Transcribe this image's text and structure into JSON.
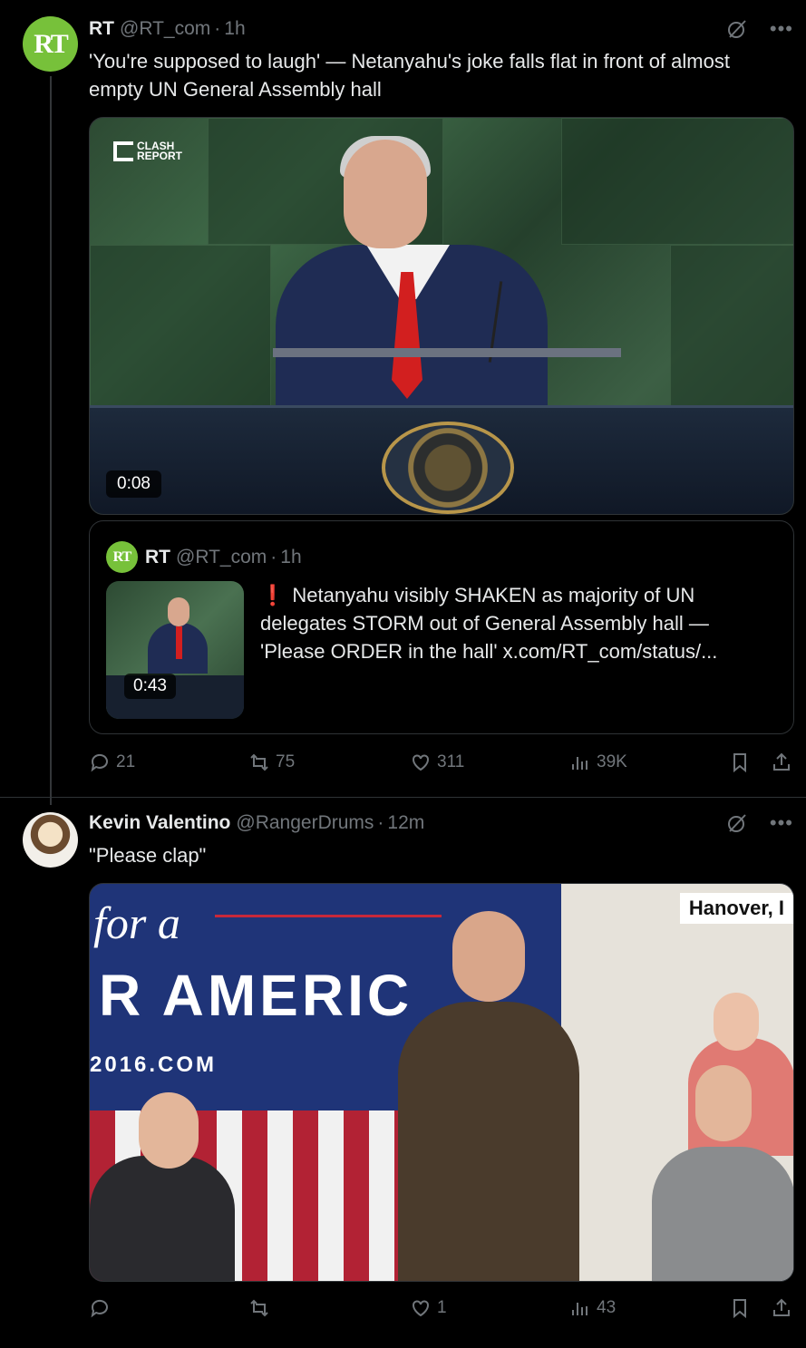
{
  "tweets": [
    {
      "author": "RT",
      "handle": "@RT_com",
      "time": "1h",
      "avatar_text": "RT",
      "text": "'You're supposed to laugh' — Netanyahu's joke falls flat in front of almost empty UN General Assembly hall",
      "media": {
        "duration": "0:08",
        "watermark_line1": "CLASH",
        "watermark_line2": "REPORT"
      },
      "quote": {
        "author": "RT",
        "handle": "@RT_com",
        "time": "1h",
        "avatar_text": "RT",
        "alert_icon": "❗",
        "text": "Netanyahu visibly SHAKEN as majority of UN delegates STORM out of General Assembly hall — 'Please ORDER in the hall'  x.com/RT_com/status/...",
        "duration": "0:43"
      },
      "actions": {
        "replies": "21",
        "reposts": "75",
        "likes": "311",
        "views": "39K"
      }
    },
    {
      "author": "Kevin Valentino",
      "handle": "@RangerDrums",
      "time": "12m",
      "text": "\"Please clap\"",
      "media": {
        "banner_line1": "for a",
        "banner_line2": "R AMERIC",
        "banner_line3": "2016.COM",
        "location": "Hanover, I"
      },
      "actions": {
        "replies": "",
        "reposts": "",
        "likes": "1",
        "views": "43"
      }
    }
  ],
  "colors": {
    "background": "#000000",
    "text": "#e7e9ea",
    "muted": "#71767b",
    "border": "#2f3336",
    "rt_green": "#77c13a"
  },
  "icons": [
    "grok-icon",
    "more-icon",
    "reply-icon",
    "repost-icon",
    "like-icon",
    "views-icon",
    "bookmark-icon",
    "share-icon"
  ]
}
